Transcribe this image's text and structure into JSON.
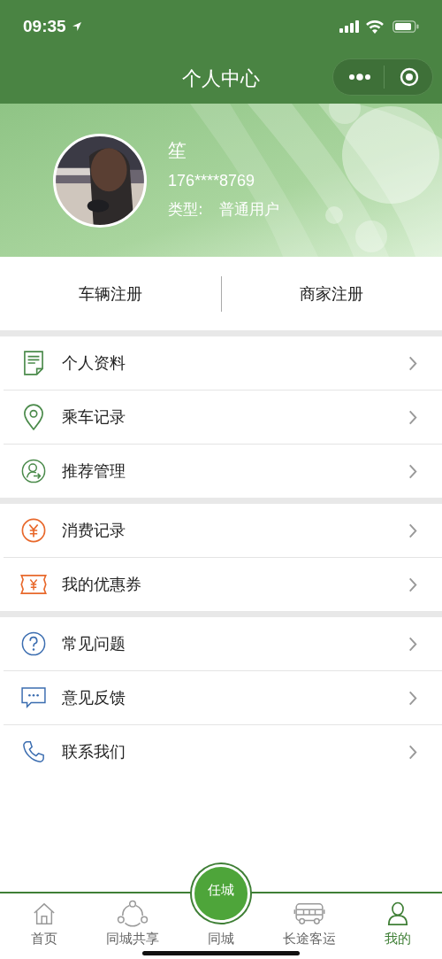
{
  "status_bar": {
    "time": "09:35"
  },
  "nav": {
    "title": "个人中心"
  },
  "profile": {
    "name": "笙",
    "phone": "176****8769",
    "type_label": "类型:",
    "type_value": "普通用户"
  },
  "register": [
    "车辆注册",
    "商家注册"
  ],
  "menu_groups": [
    {
      "items": [
        {
          "label": "个人资料"
        },
        {
          "label": "乘车记录"
        },
        {
          "label": "推荐管理"
        }
      ]
    },
    {
      "items": [
        {
          "label": "消费记录"
        },
        {
          "label": "我的优惠券"
        }
      ]
    },
    {
      "items": [
        {
          "label": "常见问题"
        },
        {
          "label": "意见反馈"
        },
        {
          "label": "联系我们"
        }
      ]
    }
  ],
  "tab_bar": {
    "center_button": "任城",
    "tabs": [
      {
        "label": "首页",
        "selected": false
      },
      {
        "label": "同城共享",
        "selected": false
      },
      {
        "label": "同城",
        "selected": false
      },
      {
        "label": "长途客运",
        "selected": false
      },
      {
        "label": "我的",
        "selected": true
      }
    ]
  }
}
